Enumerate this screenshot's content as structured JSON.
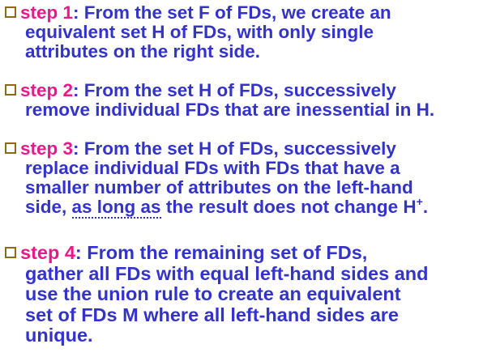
{
  "steps": [
    {
      "label": "step 1",
      "sep": ":",
      "lines": [
        " From the set F of FDs, we create an",
        "equivalent set H of FDs, with only single",
        "attributes on the right side."
      ]
    },
    {
      "label": "step 2",
      "sep": ":",
      "lines": [
        " From the set H of FDs, successively",
        "remove individual FDs that are inessential in H."
      ]
    },
    {
      "label": "step 3",
      "sep": ":",
      "lines": [
        " From the set H of FDs, successively",
        "replace individual FDs with FDs that have a",
        "smaller number of attributes on the left-hand"
      ],
      "last_line": {
        "before": "side, ",
        "underlined": "as long as",
        "after": " the result does not change H",
        "sup": "+",
        "end": "."
      }
    },
    {
      "label": "step 4",
      "sep": ":",
      "lines": [
        " From the remaining set of FDs,",
        "gather all FDs with equal left-hand sides and",
        "use the union rule to create an equivalent",
        "set of FDs M where all left-hand sides are",
        "unique."
      ]
    }
  ],
  "colors": {
    "text": "#3333cc",
    "step_label": "#e8198b",
    "bullet": "#8c6a1a"
  },
  "icons": {
    "bullet": "hollow-square-bullet-icon"
  }
}
